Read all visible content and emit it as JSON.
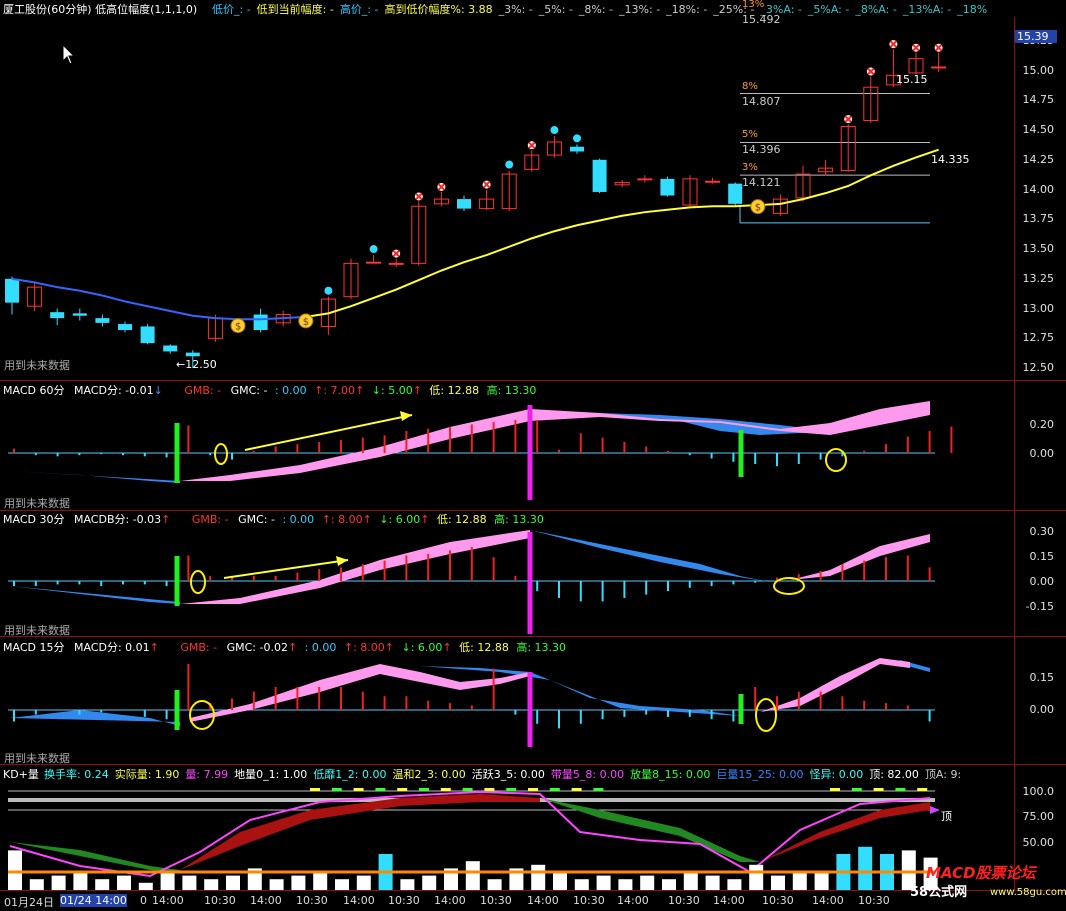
{
  "header": {
    "title": "厦工股份(60分钟) 低高位幅度(1,1,1,0)",
    "items": [
      {
        "label": "低价_: -",
        "color": "#33c8ff"
      },
      {
        "label": "低到当前幅度: -",
        "color": "#ffff44"
      },
      {
        "label": "高价_: -",
        "color": "#33c8ff"
      },
      {
        "label": "高到低价幅度%: 3.88",
        "color": "#ffff44"
      },
      {
        "label": "_3%: -",
        "color": "#cccccc"
      },
      {
        "label": "_5%: -",
        "color": "#cccccc"
      },
      {
        "label": "_8%: -",
        "color": "#cccccc"
      },
      {
        "label": "_13%: -",
        "color": "#cccccc"
      },
      {
        "label": "_18%: -",
        "color": "#cccccc"
      },
      {
        "label": "_25%: -",
        "color": "#cccccc"
      },
      {
        "label": "_3%A: -",
        "color": "#33c8c8"
      },
      {
        "label": "_5%A: -",
        "color": "#33c8c8"
      },
      {
        "label": "_8%A: -",
        "color": "#33c8c8"
      },
      {
        "label": "_13%A: -",
        "color": "#33c8c8"
      },
      {
        "label": "_18%",
        "color": "#33c8c8"
      }
    ]
  },
  "main_chart": {
    "price_axis": [
      "15.25",
      "15.00",
      "14.75",
      "14.50",
      "14.25",
      "14.00",
      "13.75",
      "13.50",
      "13.25",
      "13.00",
      "12.75",
      "12.50"
    ],
    "current_price": "15.39",
    "low_label": "←12.50",
    "ma_label": "14.335",
    "high_label": "15.15",
    "levels": [
      {
        "pct": "13%",
        "price": "15.492"
      },
      {
        "pct": "8%",
        "price": "14.807"
      },
      {
        "pct": "5%",
        "price": "14.396"
      },
      {
        "pct": "3%",
        "price": "14.121"
      }
    ],
    "watermark": "用到未来数据"
  },
  "macd60": {
    "title": "MACD 60分",
    "macd": "MACD分: -0.01",
    "gmb": "GMB: -",
    "gmc": "GMC: -",
    "v1": ": 0.00",
    "v2": "↑: 7.00",
    "v3": "↓: 5.00",
    "low": "低: 12.88",
    "high": "高: 13.30",
    "axis": [
      "0.20",
      "0.00"
    ],
    "watermark": "用到未来数据"
  },
  "macd30": {
    "title": "MACD 30分",
    "macd": "MACDB分: -0.03",
    "gmb": "GMB: -",
    "gmc": "GMC: -",
    "v1": ": 0.00",
    "v2": "↑: 8.00",
    "v3": "↓: 6.00",
    "low": "低: 12.88",
    "high": "高: 13.30",
    "axis": [
      "0.30",
      "0.15",
      "0.00",
      "-0.15"
    ],
    "watermark": "用到未来数据"
  },
  "macd15": {
    "title": "MACD 15分",
    "macd": "MACD分: 0.01",
    "gmb": "GMB: -",
    "gmc": "GMC: -0.02",
    "v1": ": 0.00",
    "v2": "↑: 8.00",
    "v3": "↓: 6.00",
    "low": "低: 12.88",
    "high": "高: 13.30",
    "axis": [
      "0.15",
      "0.00"
    ],
    "watermark": "用到未来数据"
  },
  "kd": {
    "title": "KD+量",
    "items": [
      {
        "label": "换手率: 0.24",
        "color": "#33ffff"
      },
      {
        "label": "实际量: 1.90",
        "color": "#ffff44"
      },
      {
        "label": "量: 7.99",
        "color": "#ff44ff"
      },
      {
        "label": "地量0_1: 1.00",
        "color": "#ffffff"
      },
      {
        "label": "低靡1_2: 0.00",
        "color": "#33ffff"
      },
      {
        "label": "温和2_3: 0.00",
        "color": "#ffff44"
      },
      {
        "label": "活跃3_5: 0.00",
        "color": "#ffffff"
      },
      {
        "label": "带量5_8: 0.00",
        "color": "#ff44ff"
      },
      {
        "label": "放量8_15: 0.00",
        "color": "#33ff33"
      },
      {
        "label": "巨量15_25: 0.00",
        "color": "#3388ff"
      },
      {
        "label": "怪异: 0.00",
        "color": "#33ffff"
      },
      {
        "label": "顶: 82.00",
        "color": "#ffffff"
      },
      {
        "label": "顶A: 9:",
        "color": "#cccccc"
      }
    ],
    "axis": [
      "100.0",
      "75.00",
      "50.00"
    ],
    "top_label": "顶"
  },
  "time_axis": [
    "01月24日",
    "01/24 14:00",
    "0",
    "14:00",
    "10:30",
    "14:00",
    "10:30",
    "14:00",
    "10:30",
    "14:00",
    "10:30",
    "14:00",
    "10:30",
    "14:00",
    "10:30",
    "14:00",
    "10:30",
    "14:00",
    "10:30"
  ],
  "brand": {
    "text1": "MACD股票论坛",
    "text2": "58公式网",
    "text3": "www.58gu.com"
  },
  "chart_data": {
    "type": "candlestick",
    "title": "厦工股份(60分钟)",
    "ylim": [
      12.4,
      15.45
    ],
    "candles": [
      [
        13.25,
        13.05,
        13.27,
        12.95
      ],
      [
        13.02,
        13.18,
        13.22,
        12.98
      ],
      [
        12.97,
        12.92,
        13.0,
        12.86
      ],
      [
        12.96,
        12.94,
        13.0,
        12.9
      ],
      [
        12.92,
        12.88,
        12.95,
        12.85
      ],
      [
        12.87,
        12.82,
        12.89,
        12.8
      ],
      [
        12.85,
        12.71,
        12.87,
        12.7
      ],
      [
        12.69,
        12.64,
        12.7,
        12.62
      ],
      [
        12.63,
        12.6,
        12.65,
        12.5
      ],
      [
        12.75,
        12.92,
        12.95,
        12.72
      ],
      [
        12.88,
        12.87,
        12.9,
        12.84
      ],
      [
        12.95,
        12.82,
        13.0,
        12.8
      ],
      [
        12.88,
        12.95,
        12.98,
        12.85
      ],
      [
        12.9,
        12.9,
        12.93,
        12.88
      ],
      [
        12.85,
        13.08,
        13.1,
        12.78
      ],
      [
        13.1,
        13.38,
        13.42,
        13.08
      ],
      [
        13.39,
        13.39,
        13.45,
        13.38
      ],
      [
        13.38,
        13.38,
        13.42,
        13.35
      ],
      [
        13.38,
        13.86,
        13.9,
        13.36
      ],
      [
        13.88,
        13.92,
        13.98,
        13.86
      ],
      [
        13.92,
        13.84,
        13.95,
        13.82
      ],
      [
        13.84,
        13.92,
        14.0,
        13.83
      ],
      [
        13.84,
        14.13,
        14.16,
        13.82
      ],
      [
        14.17,
        14.29,
        14.33,
        14.15
      ],
      [
        14.29,
        14.4,
        14.45,
        14.27
      ],
      [
        14.36,
        14.32,
        14.38,
        14.3
      ],
      [
        14.25,
        13.98,
        14.26,
        13.97
      ],
      [
        14.04,
        14.06,
        14.08,
        14.02
      ],
      [
        14.09,
        14.09,
        14.12,
        14.06
      ],
      [
        14.09,
        13.95,
        14.11,
        13.94
      ],
      [
        13.87,
        14.09,
        14.12,
        13.86
      ],
      [
        14.07,
        14.07,
        14.1,
        14.05
      ],
      [
        14.05,
        13.88,
        14.06,
        13.86
      ],
      [
        13.86,
        13.86,
        13.88,
        13.84
      ],
      [
        13.8,
        13.92,
        13.96,
        13.78
      ],
      [
        13.93,
        14.13,
        14.2,
        13.9
      ],
      [
        14.15,
        14.18,
        14.25,
        14.12
      ],
      [
        14.16,
        14.53,
        14.55,
        14.15
      ],
      [
        14.58,
        14.86,
        14.95,
        14.56
      ],
      [
        14.88,
        14.96,
        15.18,
        14.86
      ],
      [
        14.98,
        15.1,
        15.15,
        14.97
      ],
      [
        15.03,
        15.03,
        15.15,
        14.99
      ]
    ],
    "ma": [
      13.25,
      13.22,
      13.18,
      13.15,
      13.11,
      13.06,
      13.02,
      12.98,
      12.94,
      12.92,
      12.91,
      12.91,
      12.92,
      12.93,
      12.96,
      13.02,
      13.09,
      13.16,
      13.24,
      13.32,
      13.39,
      13.45,
      13.52,
      13.59,
      13.65,
      13.7,
      13.74,
      13.78,
      13.81,
      13.83,
      13.85,
      13.86,
      13.86,
      13.87,
      13.88,
      13.92,
      13.97,
      14.03,
      14.12,
      14.2,
      14.27,
      14.335
    ]
  }
}
